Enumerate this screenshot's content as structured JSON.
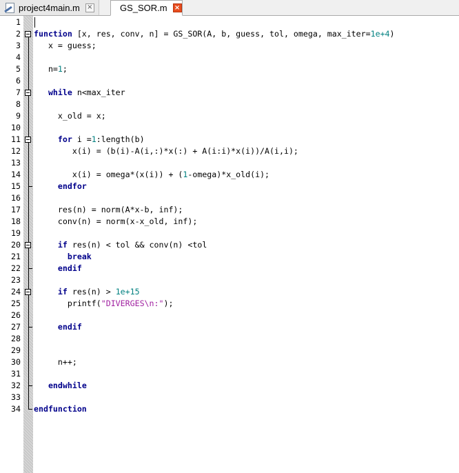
{
  "tabs": [
    {
      "label": "project4main.m",
      "active": false,
      "icon": "file-icon",
      "close": "×"
    },
    {
      "label": "GS_SOR.m",
      "active": true,
      "close": "×"
    }
  ],
  "colors": {
    "keyword": "#00008b",
    "number": "#008080",
    "string": "#a020a0",
    "close_active": "#e84c1e"
  },
  "code_lines": [
    [
      {
        "t": ""
      }
    ],
    [
      {
        "k": "kw",
        "t": "function"
      },
      {
        "t": " [x, res, conv, n] = GS_SOR(A, b, guess, tol, omega, max_iter="
      },
      {
        "k": "num",
        "t": "1e+4"
      },
      {
        "t": ")"
      }
    ],
    [
      {
        "t": "   x = guess;"
      }
    ],
    [
      {
        "t": ""
      }
    ],
    [
      {
        "t": "   n="
      },
      {
        "k": "num",
        "t": "1"
      },
      {
        "t": ";"
      }
    ],
    [
      {
        "t": ""
      }
    ],
    [
      {
        "t": "   "
      },
      {
        "k": "kw",
        "t": "while"
      },
      {
        "t": " n<max_iter"
      }
    ],
    [
      {
        "t": ""
      }
    ],
    [
      {
        "t": "     x_old = x;"
      }
    ],
    [
      {
        "t": ""
      }
    ],
    [
      {
        "t": "     "
      },
      {
        "k": "kw",
        "t": "for"
      },
      {
        "t": " i ="
      },
      {
        "k": "num",
        "t": "1"
      },
      {
        "t": ":length(b)"
      }
    ],
    [
      {
        "t": "        x(i) = (b(i)-A(i,:)*x(:) + A(i:i)*x(i))/A(i,i);"
      }
    ],
    [
      {
        "t": ""
      }
    ],
    [
      {
        "t": "        x(i) = omega*(x(i)) + ("
      },
      {
        "k": "num",
        "t": "1"
      },
      {
        "t": "-omega)*x_old(i);"
      }
    ],
    [
      {
        "t": "     "
      },
      {
        "k": "kw",
        "t": "endfor"
      }
    ],
    [
      {
        "t": ""
      }
    ],
    [
      {
        "t": "     res(n) = norm(A*x-b, inf);"
      }
    ],
    [
      {
        "t": "     conv(n) = norm(x-x_old, inf);"
      }
    ],
    [
      {
        "t": ""
      }
    ],
    [
      {
        "t": "     "
      },
      {
        "k": "kw",
        "t": "if"
      },
      {
        "t": " res(n) < tol && conv(n) <tol"
      }
    ],
    [
      {
        "t": "       "
      },
      {
        "k": "kw",
        "t": "break"
      }
    ],
    [
      {
        "t": "     "
      },
      {
        "k": "kw",
        "t": "endif"
      }
    ],
    [
      {
        "t": ""
      }
    ],
    [
      {
        "t": "     "
      },
      {
        "k": "kw",
        "t": "if"
      },
      {
        "t": " res(n) > "
      },
      {
        "k": "num",
        "t": "1e+15"
      }
    ],
    [
      {
        "t": "       printf("
      },
      {
        "k": "str",
        "t": "\"DIVERGES\\n:\""
      },
      {
        "t": ");"
      }
    ],
    [
      {
        "t": ""
      }
    ],
    [
      {
        "t": "     "
      },
      {
        "k": "kw",
        "t": "endif"
      }
    ],
    [
      {
        "t": ""
      }
    ],
    [
      {
        "t": ""
      }
    ],
    [
      {
        "t": "     n++;"
      }
    ],
    [
      {
        "t": ""
      }
    ],
    [
      {
        "t": "   "
      },
      {
        "k": "kw",
        "t": "endwhile"
      }
    ],
    [
      {
        "t": ""
      }
    ],
    [
      {
        "k": "kw",
        "t": "endfunction"
      }
    ]
  ],
  "line_numbers": [
    "1",
    "2",
    "3",
    "4",
    "5",
    "6",
    "7",
    "8",
    "9",
    "10",
    "11",
    "12",
    "13",
    "14",
    "15",
    "16",
    "17",
    "18",
    "19",
    "20",
    "21",
    "22",
    "23",
    "24",
    "25",
    "26",
    "27",
    "28",
    "29",
    "30",
    "31",
    "32",
    "33",
    "34"
  ]
}
